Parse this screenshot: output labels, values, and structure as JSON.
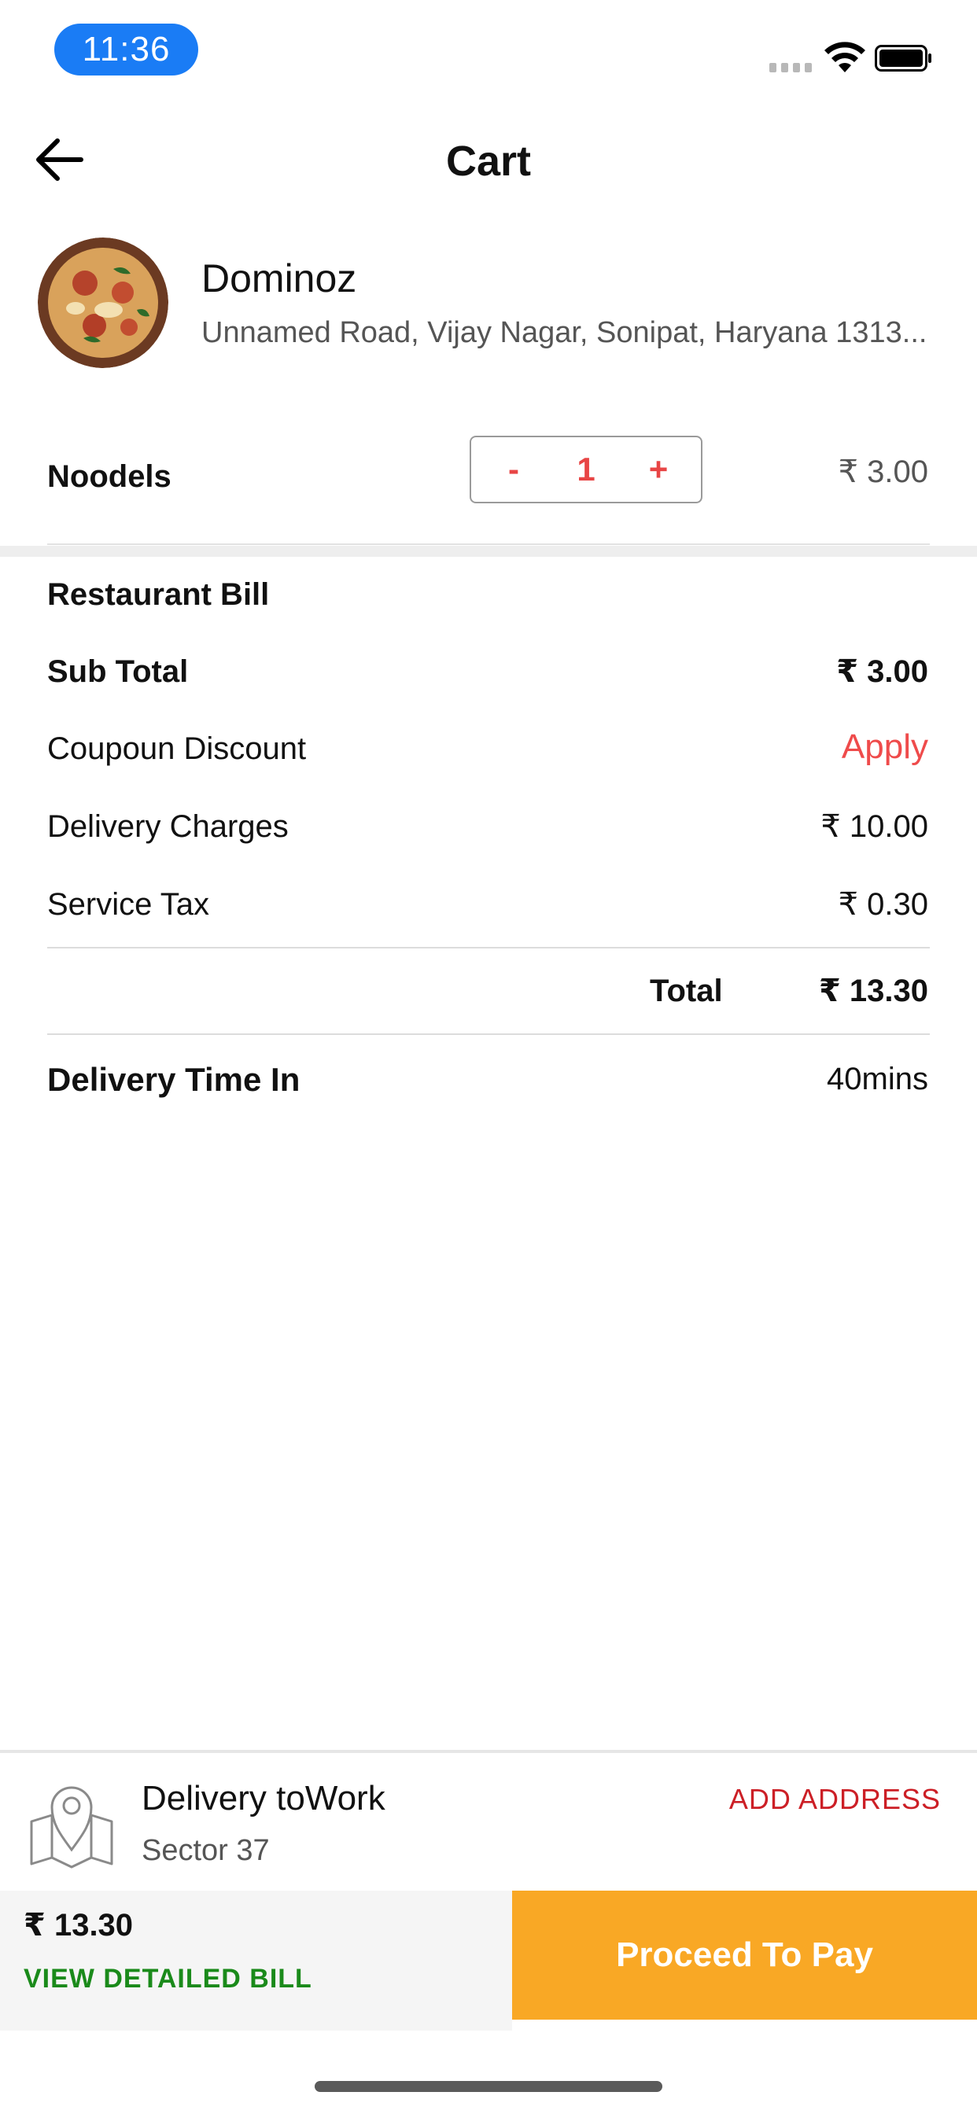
{
  "status_bar": {
    "time": "11:36"
  },
  "header": {
    "title": "Cart"
  },
  "restaurant": {
    "name": "Dominoz",
    "address": "Unnamed Road, Vijay Nagar, Sonipat, Haryana 1313..."
  },
  "item": {
    "name": "Noodels",
    "minus": "-",
    "quantity": "1",
    "plus": "+",
    "price": "₹ 3.00"
  },
  "bill": {
    "heading": "Restaurant Bill",
    "sub_total_label": "Sub Total",
    "sub_total_value": "₹ 3.00",
    "coupon_label": "Coupoun Discount",
    "coupon_action": "Apply",
    "delivery_label": "Delivery Charges",
    "delivery_value": "₹ 10.00",
    "tax_label": "Service Tax",
    "tax_value": "₹ 0.30",
    "total_label": "Total",
    "total_value": "₹ 13.30",
    "time_label": "Delivery Time In",
    "time_value": "40mins"
  },
  "address": {
    "title": "Delivery toWork",
    "subtitle": "Sector 37",
    "add_label": "ADD ADDRESS"
  },
  "footer": {
    "amount": "₹ 13.30",
    "view_bill": "VIEW DETAILED BILL",
    "proceed": "Proceed To Pay"
  },
  "colors": {
    "accent_red": "#ef4b4b",
    "proceed_orange": "#f9a825",
    "view_bill_green": "#1a8a1a",
    "time_pill_blue": "#1a7cf5"
  }
}
